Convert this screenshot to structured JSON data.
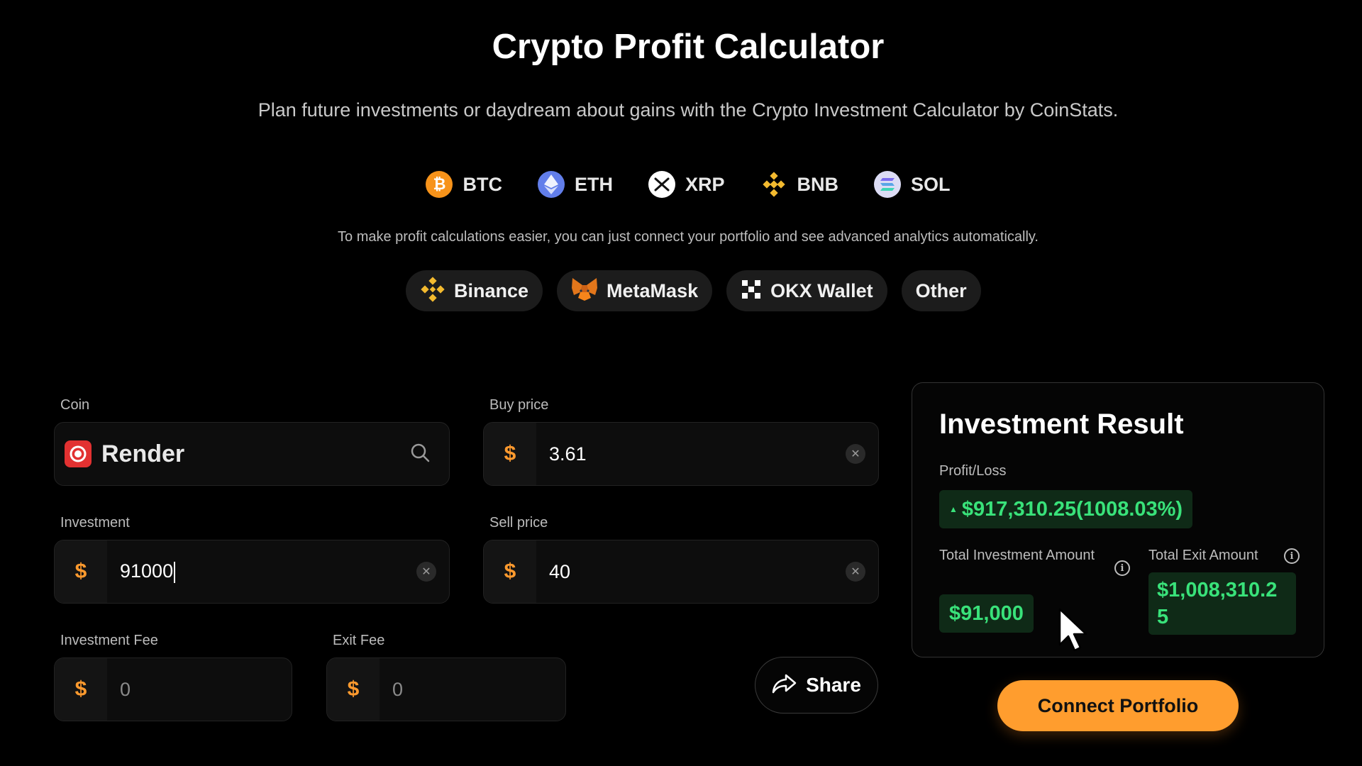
{
  "header": {
    "title": "Crypto Profit Calculator",
    "subtitle": "Plan future investments or daydream about gains with the Crypto Investment Calculator by CoinStats."
  },
  "coins": [
    {
      "symbol": "BTC",
      "icon": "bitcoin-icon",
      "color": "#f7931a"
    },
    {
      "symbol": "ETH",
      "icon": "ethereum-icon",
      "color": "#627eea"
    },
    {
      "symbol": "XRP",
      "icon": "xrp-icon",
      "color": "#ffffff"
    },
    {
      "symbol": "BNB",
      "icon": "bnb-icon",
      "color": "#f3ba2f"
    },
    {
      "symbol": "SOL",
      "icon": "solana-icon",
      "color": "#dcdcf5"
    }
  ],
  "hint": "To make profit calculations easier, you can just connect your portfolio and see advanced analytics automatically.",
  "wallets": [
    {
      "label": "Binance",
      "icon": "binance-icon"
    },
    {
      "label": "MetaMask",
      "icon": "metamask-fox-icon"
    },
    {
      "label": "OKX Wallet",
      "icon": "okx-icon"
    },
    {
      "label": "Other"
    }
  ],
  "form": {
    "coin": {
      "label": "Coin",
      "value": "Render",
      "icon": "render-icon"
    },
    "buy_price": {
      "label": "Buy price",
      "currency": "$",
      "value": "3.61"
    },
    "investment": {
      "label": "Investment",
      "currency": "$",
      "value": "91000"
    },
    "sell_price": {
      "label": "Sell price",
      "currency": "$",
      "value": "40"
    },
    "investment_fee": {
      "label": "Investment Fee",
      "currency": "$",
      "value": "0"
    },
    "exit_fee": {
      "label": "Exit Fee",
      "currency": "$",
      "value": "0"
    },
    "share_label": "Share"
  },
  "result": {
    "title": "Investment Result",
    "profit_label": "Profit/Loss",
    "profit_value": "$917,310.25(1008.03%)",
    "total_investment_label": "Total Investment Amount",
    "total_investment_value": "$91,000",
    "total_exit_label": "Total Exit Amount",
    "total_exit_value": "$1,008,310.25"
  },
  "connect_label": "Connect Portfolio",
  "colors": {
    "accent": "#ff9d2e",
    "profit_green": "#39e27a",
    "background": "#000000"
  }
}
